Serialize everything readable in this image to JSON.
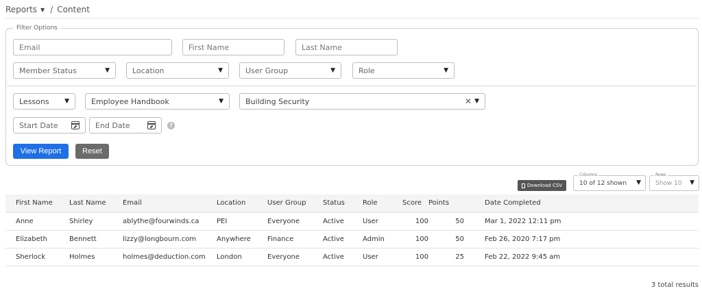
{
  "breadcrumb": {
    "root": "Reports",
    "separator": "/",
    "current": "Content"
  },
  "filters": {
    "legend": "Filter Options",
    "email_placeholder": "Email",
    "first_name_placeholder": "First Name",
    "last_name_placeholder": "Last Name",
    "member_status": "Member Status",
    "location": "Location",
    "user_group": "User Group",
    "role": "Role",
    "content_type": "Lessons",
    "course": "Employee Handbook",
    "lesson": "Building Security",
    "start_date_placeholder": "Start Date",
    "end_date_placeholder": "End Date",
    "help": "?",
    "view_report": "View Report",
    "reset": "Reset"
  },
  "toolbar": {
    "download_csv": "Download CSV",
    "columns_label": "Columns",
    "columns_value": "10 of 12 shown",
    "rows_label": "Rows",
    "rows_value": "Show 10"
  },
  "table": {
    "headers": [
      "First Name",
      "Last Name",
      "Email",
      "Location",
      "User Group",
      "Status",
      "Role",
      "Score",
      "Points",
      "Date Completed"
    ],
    "rows": [
      [
        "Anne",
        "Shirley",
        "ablythe@fourwinds.ca",
        "PEI",
        "Everyone",
        "Active",
        "User",
        "100",
        "50",
        "Mar 1, 2022 12:11 pm"
      ],
      [
        "Elizabeth",
        "Bennett",
        "lizzy@longbourn.com",
        "Anywhere",
        "Finance",
        "Active",
        "Admin",
        "100",
        "50",
        "Feb 26, 2020 7:17 pm"
      ],
      [
        "Sherlock",
        "Holmes",
        "holmes@deduction.com",
        "London",
        "Everyone",
        "Active",
        "User",
        "100",
        "25",
        "Feb 22, 2022 9:45 am"
      ]
    ]
  },
  "footer": {
    "total": "3 total results"
  },
  "colors": {
    "primary": "#1f6fe5",
    "secondary": "#6b6b6b",
    "csv": "#555555"
  },
  "icons": [
    "caret-down-icon",
    "calendar-icon",
    "help-icon",
    "clear-icon",
    "document-icon"
  ]
}
